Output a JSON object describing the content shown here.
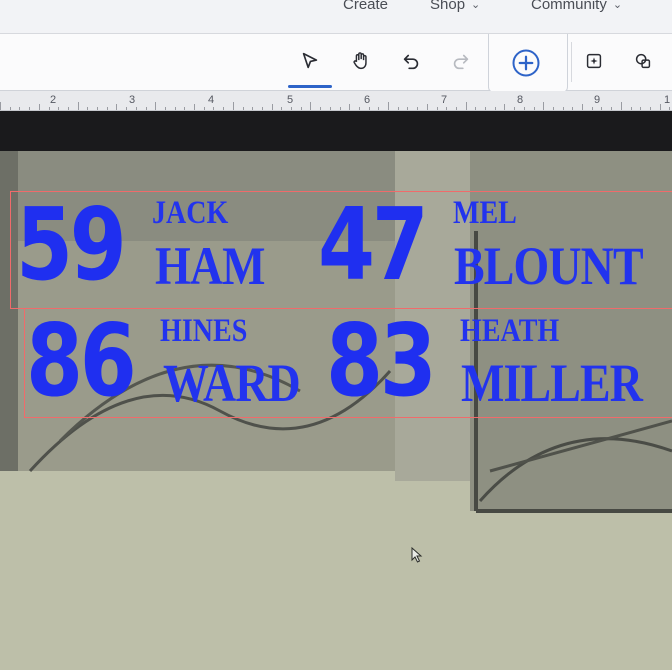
{
  "nav": {
    "items": [
      {
        "label": "Create",
        "has_chevron": false
      },
      {
        "label": "Shop",
        "has_chevron": true
      },
      {
        "label": "Community",
        "has_chevron": true
      }
    ]
  },
  "toolbar": {
    "tools": [
      "select-arrow-icon",
      "hand-icon",
      "undo-icon",
      "redo-icon",
      "add-circle-icon",
      "sparkle-edit-icon",
      "shapes-icon"
    ],
    "active": "select-arrow-icon",
    "accent": "#2d63c8"
  },
  "ruler": {
    "labels": [
      "2",
      "3",
      "4",
      "5",
      "6",
      "7",
      "8",
      "9",
      "1"
    ]
  },
  "design": {
    "text_color": "#1f2ff0",
    "players": [
      {
        "number": "59",
        "first": "JACK",
        "last": "HAM"
      },
      {
        "number": "47",
        "first": "MEL",
        "last": "BLOUNT"
      },
      {
        "number": "86",
        "first": "HINES",
        "last": "WARD"
      },
      {
        "number": "83",
        "first": "HEATH",
        "last": "MILLER"
      }
    ]
  }
}
